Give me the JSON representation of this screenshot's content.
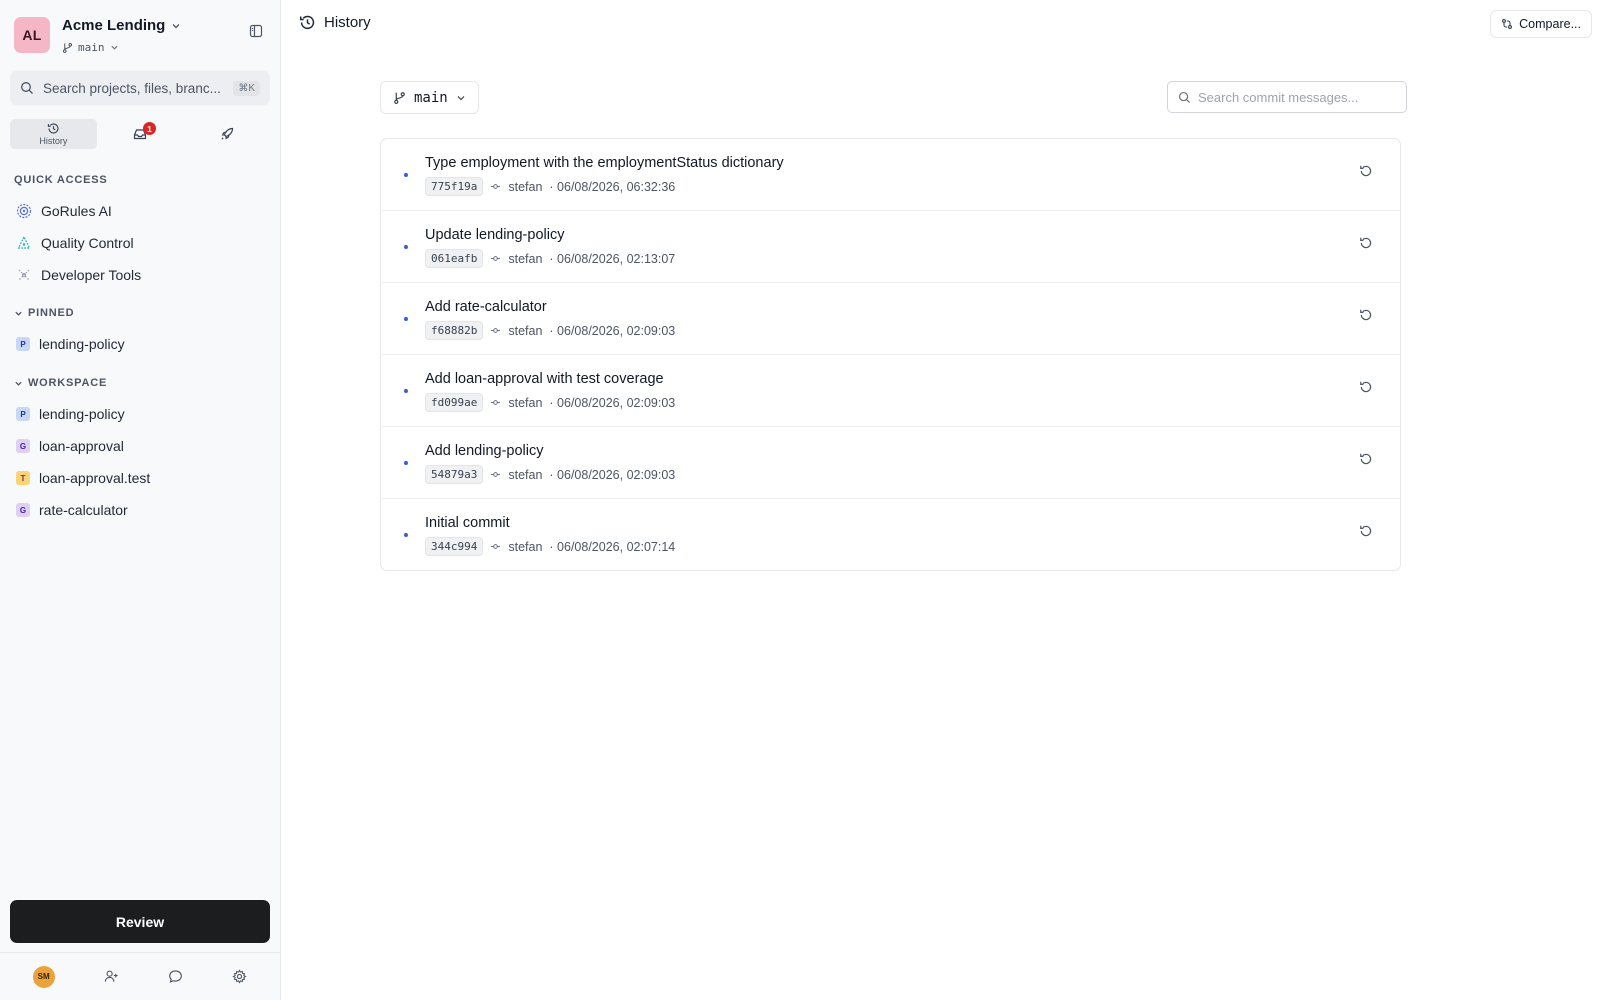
{
  "workspace": {
    "avatar_initials": "AL",
    "name": "Acme Lending",
    "branch": "main"
  },
  "search": {
    "placeholder": "Search projects, files, branc...",
    "shortcut": "⌘K"
  },
  "mode_tabs": {
    "history_label": "History",
    "inbox_badge": "1"
  },
  "quick_access": {
    "title": "QUICK ACCESS",
    "items": [
      {
        "label": "GoRules AI",
        "icon": "ai-icon"
      },
      {
        "label": "Quality Control",
        "icon": "quality-control-icon"
      },
      {
        "label": "Developer Tools",
        "icon": "developer-tools-icon"
      }
    ]
  },
  "pinned": {
    "title": "PINNED",
    "items": [
      {
        "label": "lending-policy",
        "badge": "P"
      }
    ]
  },
  "workspace_section": {
    "title": "WORKSPACE",
    "items": [
      {
        "label": "lending-policy",
        "badge": "P"
      },
      {
        "label": "loan-approval",
        "badge": "G"
      },
      {
        "label": "loan-approval.test",
        "badge": "T"
      },
      {
        "label": "rate-calculator",
        "badge": "G"
      }
    ]
  },
  "review_button": "Review",
  "footer": {
    "user_initials": "SM"
  },
  "header": {
    "title": "History",
    "compare_label": "Compare..."
  },
  "toolbar": {
    "branch": "main",
    "commit_search_placeholder": "Search commit messages..."
  },
  "commits": [
    {
      "message": "Type employment with the employmentStatus dictionary",
      "hash": "775f19a",
      "author": "stefan",
      "date": "· 06/08/2026, 06:32:36"
    },
    {
      "message": "Update lending-policy",
      "hash": "061eafb",
      "author": "stefan",
      "date": "· 06/08/2026, 02:13:07"
    },
    {
      "message": "Add rate-calculator",
      "hash": "f68882b",
      "author": "stefan",
      "date": "· 06/08/2026, 02:09:03"
    },
    {
      "message": "Add loan-approval with test coverage",
      "hash": "fd099ae",
      "author": "stefan",
      "date": "· 06/08/2026, 02:09:03"
    },
    {
      "message": "Add lending-policy",
      "hash": "54879a3",
      "author": "stefan",
      "date": "· 06/08/2026, 02:09:03"
    },
    {
      "message": "Initial commit",
      "hash": "344c994",
      "author": "stefan",
      "date": "· 06/08/2026, 02:07:14"
    }
  ],
  "colors": {
    "accent_dot": "#3b5bdb",
    "badge_red": "#dc2626",
    "review_bg": "#1c1d1f"
  }
}
